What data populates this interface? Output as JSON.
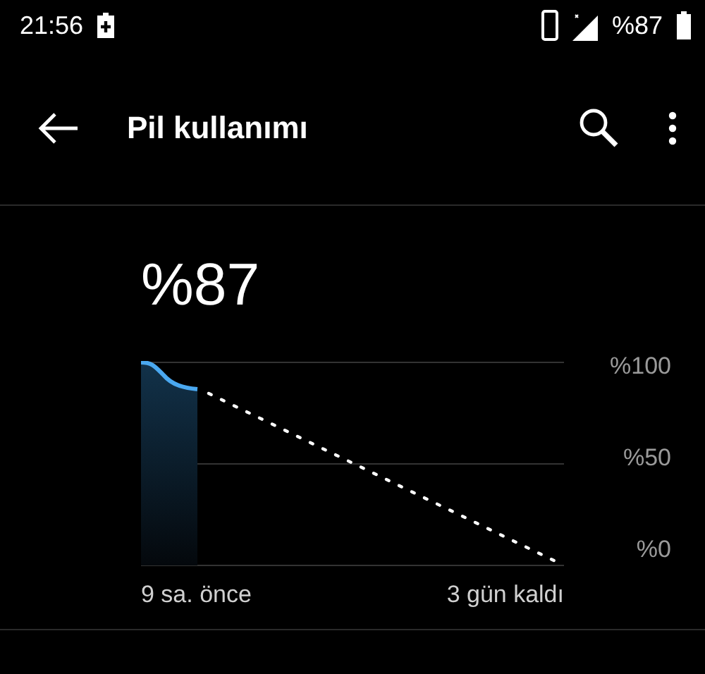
{
  "status_bar": {
    "time": "21:56",
    "battery_text": "%87",
    "charging": true
  },
  "toolbar": {
    "title": "Pil kullanımı"
  },
  "battery": {
    "percent": "%87",
    "graph": {
      "y_labels": [
        "%100",
        "%50",
        "%0"
      ],
      "start_label": "9 sa. önce",
      "end_label": "3 gün kaldı"
    }
  }
}
